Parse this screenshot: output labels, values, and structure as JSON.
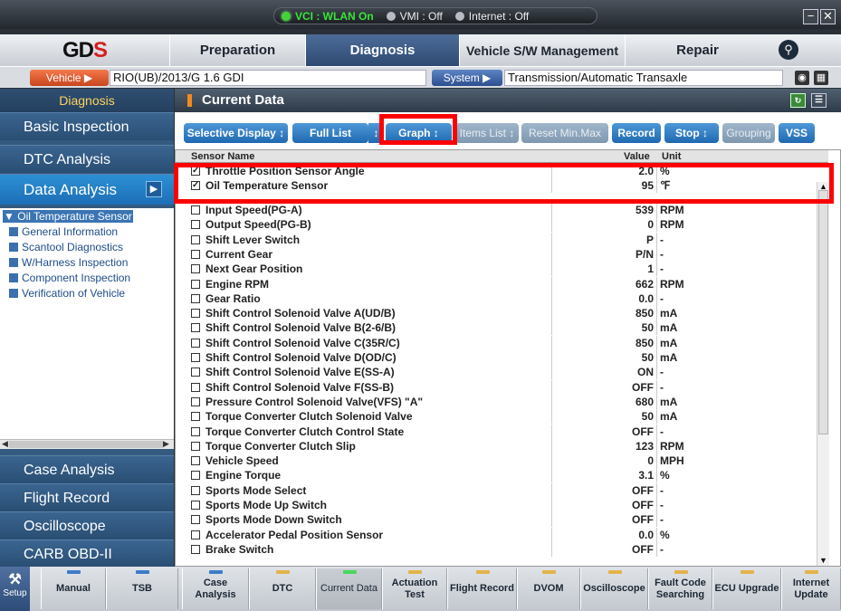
{
  "titlebar": {
    "vci": "VCI : WLAN On",
    "vmi": "VMI : Off",
    "internet": "Internet : Off",
    "minimize": "−",
    "close": "✕"
  },
  "nav": {
    "logo_left": "GD",
    "logo_right": "S",
    "tabs": [
      "Preparation",
      "Diagnosis",
      "Vehicle S/W Management",
      "Repair"
    ],
    "selected_tab": "Diagnosis"
  },
  "vehicle_bar": {
    "vehicle_label": "Vehicle ▶",
    "vehicle_value": "RIO(UB)/2013/G 1.6 GDI",
    "system_label": "System ▶",
    "system_value": "Transmission/Automatic Transaxle"
  },
  "sidebar": {
    "header": "Diagnosis",
    "items_top": [
      "Basic Inspection",
      "DTC Analysis",
      "Data Analysis"
    ],
    "selected": "Data Analysis",
    "tree_root": "Oil Temperature Sensor",
    "tree_leaves": [
      "General Information",
      "Scantool Diagnostics",
      "W/Harness Inspection",
      "Component Inspection",
      "Verification of Vehicle"
    ],
    "items_bottom": [
      "Case Analysis",
      "Flight Record",
      "Oscilloscope",
      "CARB OBD-II"
    ]
  },
  "content": {
    "title": "Current Data",
    "toolbar": [
      {
        "label": "Selective Display ↕",
        "enabled": true
      },
      {
        "label": "Full List",
        "enabled": true
      },
      {
        "label": "↕",
        "enabled": true
      },
      {
        "label": "Graph ↕",
        "enabled": true
      },
      {
        "label": "Items List ↕",
        "enabled": false
      },
      {
        "label": "Reset Min.Max",
        "enabled": false
      },
      {
        "label": "Record",
        "enabled": true
      },
      {
        "label": "Stop ↕",
        "enabled": true
      },
      {
        "label": "Grouping",
        "enabled": false
      },
      {
        "label": "VSS",
        "enabled": true
      }
    ],
    "columns": {
      "name": "Sensor Name",
      "value": "Value",
      "unit": "Unit"
    },
    "pinned_rows": [
      {
        "name": "Throttle Position Sensor Angle",
        "value": "2.0",
        "unit": "%",
        "checked": true
      },
      {
        "name": "Oil Temperature Sensor",
        "value": "95",
        "unit": "℉",
        "checked": true
      }
    ],
    "rows": [
      {
        "name": "Input Speed(PG-A)",
        "value": "539",
        "unit": "RPM"
      },
      {
        "name": "Output Speed(PG-B)",
        "value": "0",
        "unit": "RPM"
      },
      {
        "name": "Shift Lever Switch",
        "value": "P",
        "unit": "-"
      },
      {
        "name": "Current Gear",
        "value": "P/N",
        "unit": "-"
      },
      {
        "name": "Next Gear Position",
        "value": "1",
        "unit": "-"
      },
      {
        "name": "Engine RPM",
        "value": "662",
        "unit": "RPM"
      },
      {
        "name": "Gear Ratio",
        "value": "0.0",
        "unit": "-"
      },
      {
        "name": "Shift Control Solenoid Valve A(UD/B)",
        "value": "850",
        "unit": "mA"
      },
      {
        "name": "Shift Control Solenoid Valve B(2-6/B)",
        "value": "50",
        "unit": "mA"
      },
      {
        "name": "Shift Control Solenoid Valve C(35R/C)",
        "value": "850",
        "unit": "mA"
      },
      {
        "name": "Shift Control Solenoid Valve D(OD/C)",
        "value": "50",
        "unit": "mA"
      },
      {
        "name": "Shift Control Solenoid Valve E(SS-A)",
        "value": "ON",
        "unit": "-"
      },
      {
        "name": "Shift Control Solenoid Valve F(SS-B)",
        "value": "OFF",
        "unit": "-"
      },
      {
        "name": "Pressure Control Solenoid Valve(VFS) \"A\"",
        "value": "680",
        "unit": "mA"
      },
      {
        "name": "Torque Converter Clutch Solenoid Valve",
        "value": "50",
        "unit": "mA"
      },
      {
        "name": "Torque Converter Clutch Control State",
        "value": "OFF",
        "unit": "-"
      },
      {
        "name": "Torque Converter Clutch Slip",
        "value": "123",
        "unit": "RPM"
      },
      {
        "name": "Vehicle Speed",
        "value": "0",
        "unit": "MPH"
      },
      {
        "name": "Engine Torque",
        "value": "3.1",
        "unit": "%"
      },
      {
        "name": "Sports Mode Select",
        "value": "OFF",
        "unit": "-"
      },
      {
        "name": "Sports Mode Up Switch",
        "value": "OFF",
        "unit": "-"
      },
      {
        "name": "Sports Mode Down Switch",
        "value": "OFF",
        "unit": "-"
      },
      {
        "name": "Accelerator Pedal Position Sensor",
        "value": "0.0",
        "unit": "%"
      },
      {
        "name": "Brake Switch",
        "value": "OFF",
        "unit": "-"
      }
    ]
  },
  "dock": {
    "setup": "Setup",
    "buttons": [
      "Manual",
      "TSB",
      "Case Analysis",
      "DTC",
      "Current Data",
      "Actuation Test",
      "Flight Record",
      "DVOM",
      "Oscilloscope",
      "Fault Code Searching",
      "ECU Upgrade",
      "Internet Update"
    ],
    "selected": "Current Data"
  },
  "colors": {
    "highlight": "#ff0000",
    "accent": "#1f69b1",
    "selected_sidebar": "#2c8fd5"
  }
}
